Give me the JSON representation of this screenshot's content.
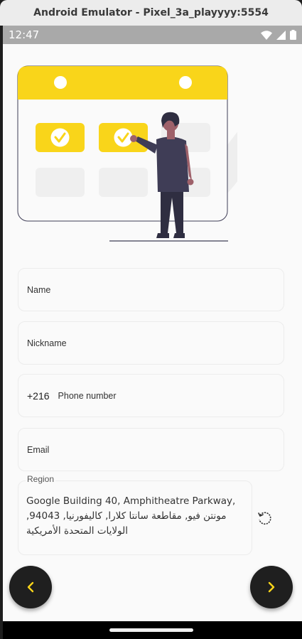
{
  "window": {
    "title": "Android Emulator - Pixel_3a_playyyy:5554"
  },
  "status_bar": {
    "time": "12:47"
  },
  "form": {
    "name_label": "Name",
    "nickname_label": "Nickname",
    "phone_prefix": "+216",
    "phone_label": "Phone number",
    "email_label": "Email",
    "region_label": "Region",
    "region_value": "Google Building 40, Amphitheatre Parkway, مونتن فيو, مقاطعة سانتا كلارا, كاليفورنيا, 94043, الولايات المتحدة الأمريكية"
  },
  "icons": {
    "back": "chevron-left-icon",
    "next": "chevron-right-icon",
    "refresh": "refresh-icon",
    "wifi": "wifi-icon",
    "signal": "signal-icon",
    "battery": "battery-icon"
  },
  "colors": {
    "accent": "#f9d51a",
    "fab": "#1f1f1f",
    "screen_bg": "#fafafa"
  }
}
